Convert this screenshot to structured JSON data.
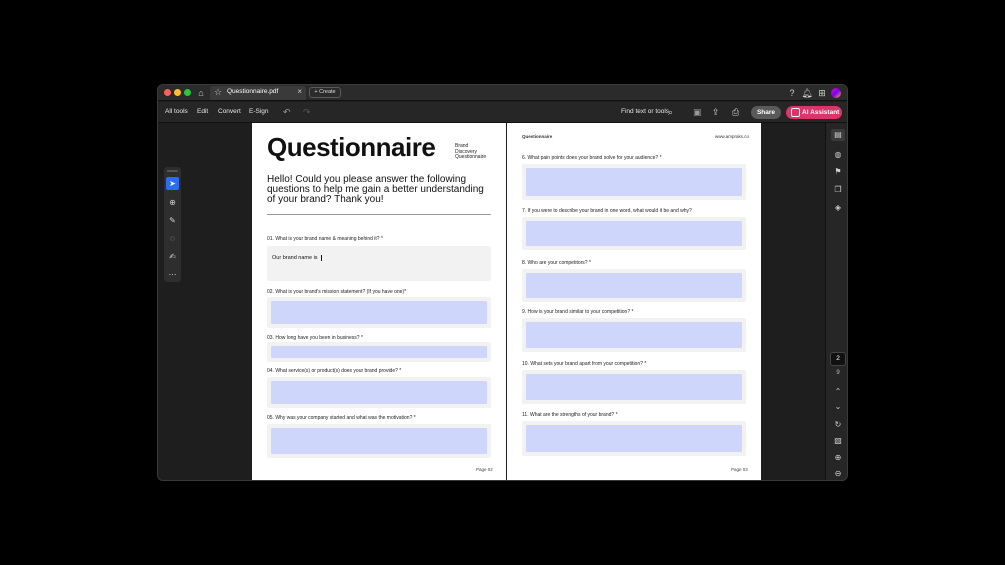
{
  "window": {
    "tab_title": "Questionnaire.pdf",
    "create_label": "Create"
  },
  "toolbar": {
    "all_tools": "All tools",
    "edit": "Edit",
    "convert": "Convert",
    "esign": "E-Sign",
    "find": "Find text or tools",
    "share": "Share",
    "ai": "AI Assistant"
  },
  "colors": {
    "ai_button": "#d9376b",
    "select_tool": "#2d6cf0",
    "answer_fill": "#cfd6fb"
  },
  "pager": {
    "current": "2",
    "total": "9"
  },
  "page1": {
    "title": "Questionnaire",
    "subtitle_lines": [
      "Brand",
      "Discovery",
      "Questionnaire"
    ],
    "intro": "Hello! Could you please answer the following questions to help me gain a better understanding of your brand? Thank you!",
    "questions": [
      {
        "label": "01. What is your brand name & meaning behind it? *",
        "answer": "Our brand name is"
      },
      {
        "label": "02. What is your brand's mission statement? (If you have one)*",
        "answer": ""
      },
      {
        "label": "03. How long have you been in business? *",
        "answer": ""
      },
      {
        "label": "04. What service(s) or product(s) does your brand provide? *",
        "answer": ""
      },
      {
        "label": "05. Why was your company started and what was the motivation? *",
        "answer": ""
      }
    ],
    "page_label": "Page 02"
  },
  "page2": {
    "header_left": "Questionnaire",
    "header_right": "www.ampraks.co",
    "questions": [
      {
        "label": "6. What pain points does your brand solve for your audience? *"
      },
      {
        "label": "7. If you were to describe your brand in one word, what would it be and why?"
      },
      {
        "label": "8. Who are your competitors? *"
      },
      {
        "label": "9. How is your brand similar to your competition? *"
      },
      {
        "label": "10. What sets your brand apart from your competition? *"
      },
      {
        "label": "11. What are the strengths of your brand? *"
      }
    ],
    "page_label": "Page 03"
  }
}
